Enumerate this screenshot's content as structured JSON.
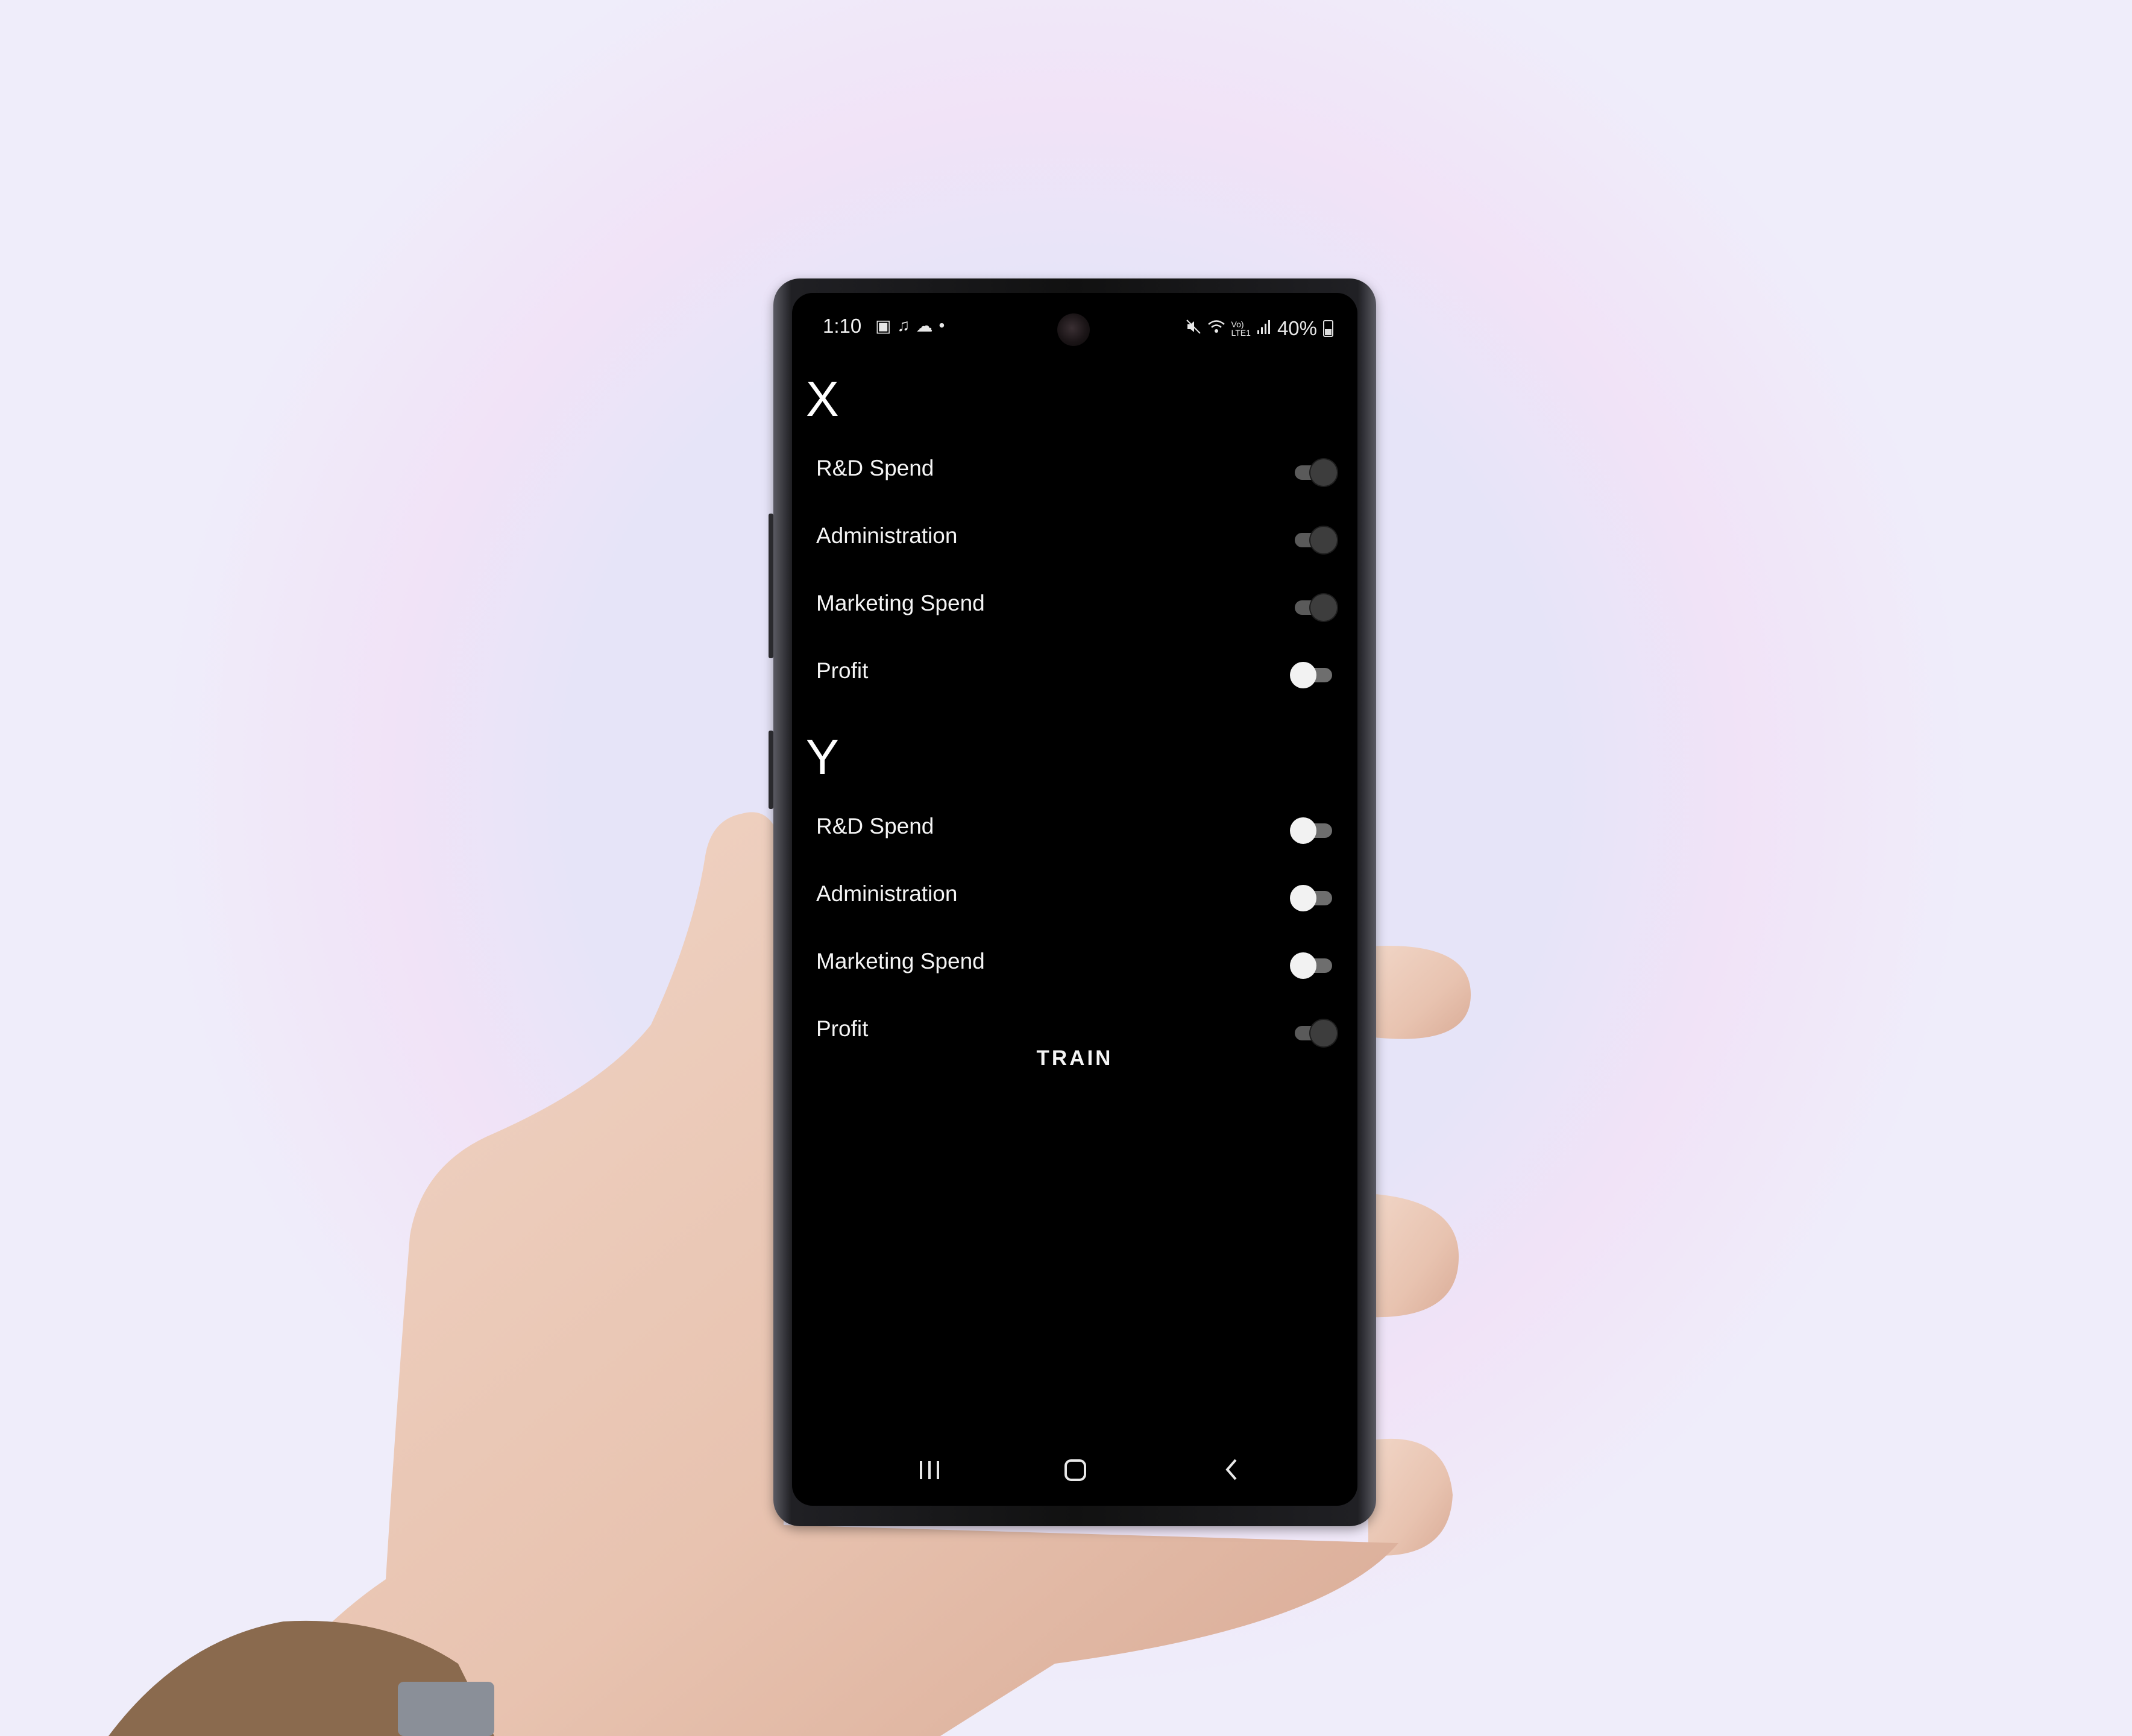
{
  "status_bar": {
    "time": "1:10",
    "battery": "40%",
    "icons": [
      "gallery-icon",
      "music-note-icon",
      "cloud-icon",
      "dot-icon",
      "mute-icon",
      "wifi-icon",
      "volte-icon",
      "signal-icon",
      "battery-icon"
    ]
  },
  "section_x": {
    "title": "X",
    "items": [
      {
        "label": "R&D Spend",
        "enabled": true
      },
      {
        "label": "Administration",
        "enabled": true
      },
      {
        "label": "Marketing Spend",
        "enabled": true
      },
      {
        "label": "Profit",
        "enabled": false
      }
    ]
  },
  "section_y": {
    "title": "Y",
    "items": [
      {
        "label": "R&D Spend",
        "enabled": false
      },
      {
        "label": "Administration",
        "enabled": false
      },
      {
        "label": "Marketing Spend",
        "enabled": false
      },
      {
        "label": "Profit",
        "enabled": true
      }
    ]
  },
  "train_button": {
    "label": "TRAIN"
  },
  "navigation": {
    "buttons": [
      "recents-icon",
      "home-icon",
      "back-icon"
    ]
  },
  "colors": {
    "screen_bg": "#000000",
    "text": "#ffffff",
    "switch_off_thumb": "#f2f2f2",
    "switch_on_thumb": "#3d3d3d"
  }
}
